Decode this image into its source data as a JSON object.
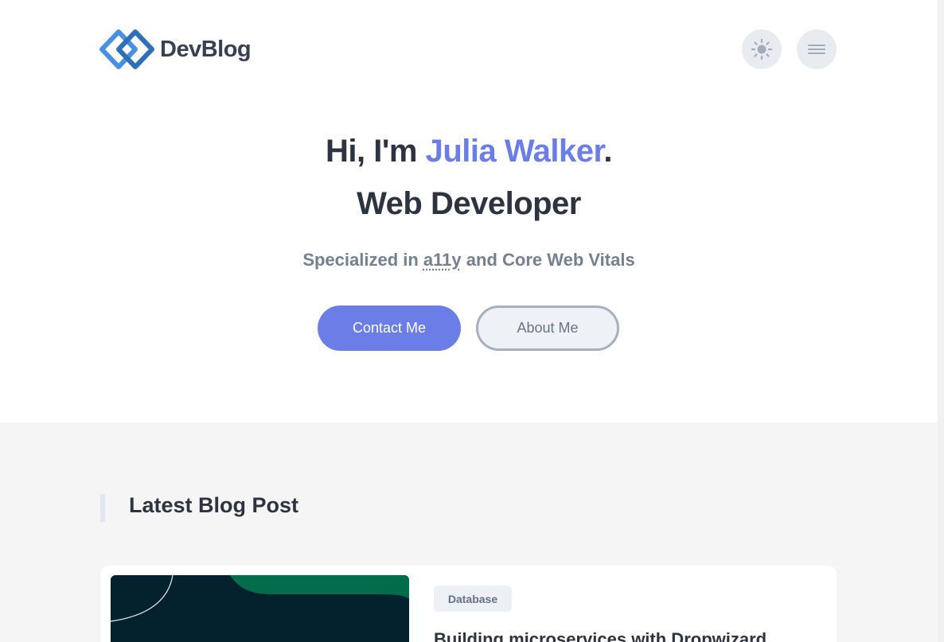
{
  "header": {
    "logo_text": "DevBlog",
    "theme_icon": "sun-icon",
    "menu_icon": "menu-icon"
  },
  "hero": {
    "greeting_prefix": "Hi, I'm ",
    "name": "Julia Walker",
    "greeting_suffix": ".",
    "role": "Web Developer",
    "subtitle_prefix": "Specialized in ",
    "subtitle_abbr": "a11y",
    "subtitle_suffix": " and Core Web Vitals",
    "contact_label": "Contact Me",
    "about_label": "About Me"
  },
  "blog": {
    "section_title": "Latest Blog Post",
    "latest_post": {
      "tag": "Database",
      "title": "Building microservices with Dropwizard"
    }
  },
  "colors": {
    "accent": "#6b7ee8",
    "heading": "#2d3340",
    "muted": "#75808f",
    "thumb_dark": "#04212e",
    "thumb_green": "#006c4a"
  }
}
